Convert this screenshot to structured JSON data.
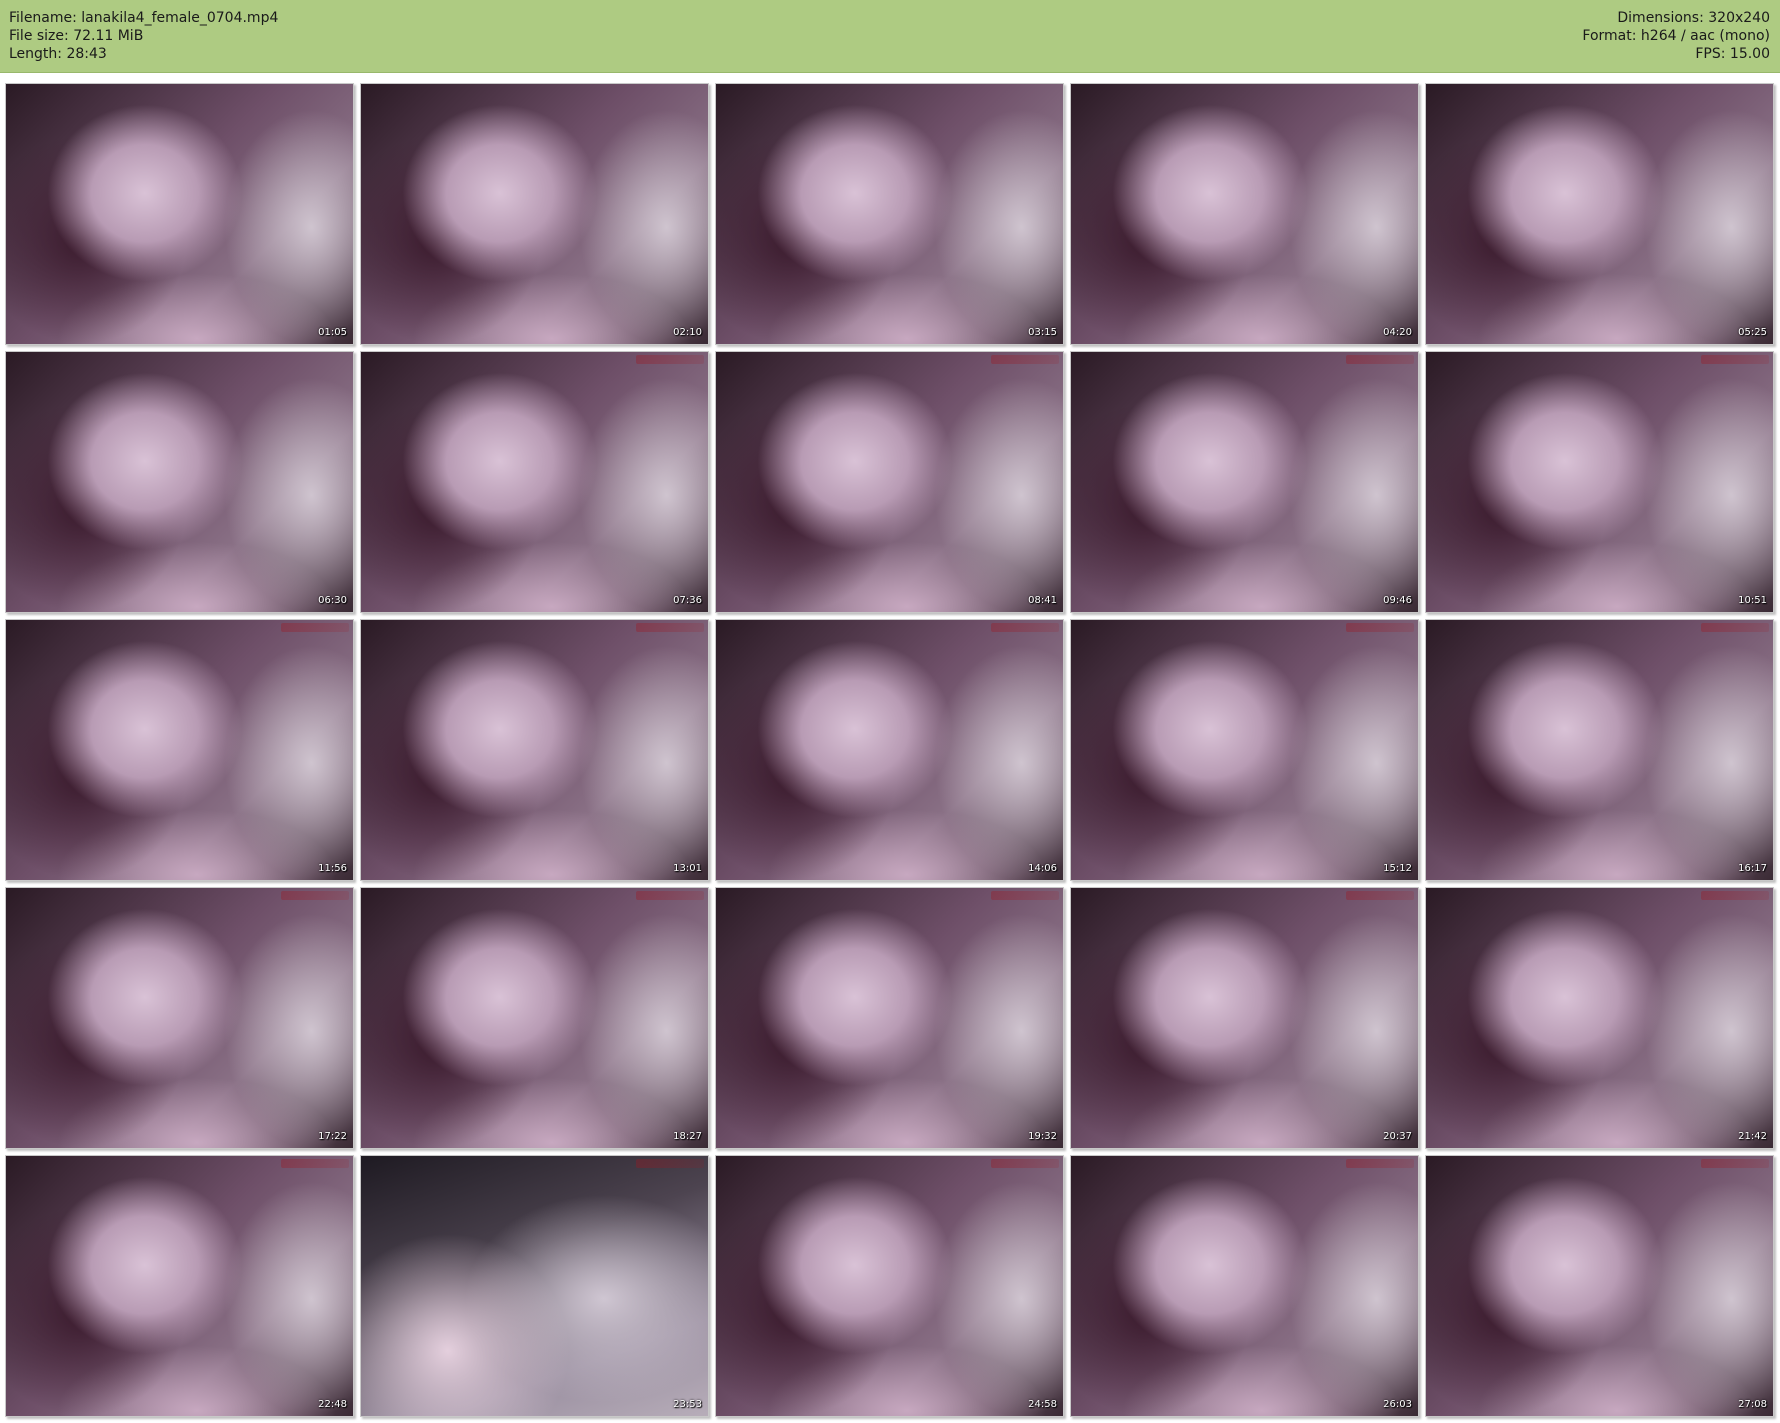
{
  "header": {
    "filename": "Filename: lanakila4_female_0704.mp4",
    "file_size": "File size: 72.11 MiB",
    "length": "Length: 28:43",
    "dimensions": "Dimensions: 320x240",
    "format": "Format: h264 / aac (mono)",
    "fps": "FPS: 15.00"
  },
  "thumbnails": [
    "01:05",
    "02:10",
    "03:15",
    "04:20",
    "05:25",
    "06:30",
    "07:36",
    "08:41",
    "09:46",
    "10:51",
    "11:56",
    "13:01",
    "14:06",
    "15:12",
    "16:17",
    "17:22",
    "18:27",
    "19:32",
    "20:37",
    "21:42",
    "22:48",
    "23:53",
    "24:58",
    "26:03",
    "27:08"
  ],
  "colors": {
    "header_bg": "#aecb82",
    "page_bg": "#ffffff"
  }
}
